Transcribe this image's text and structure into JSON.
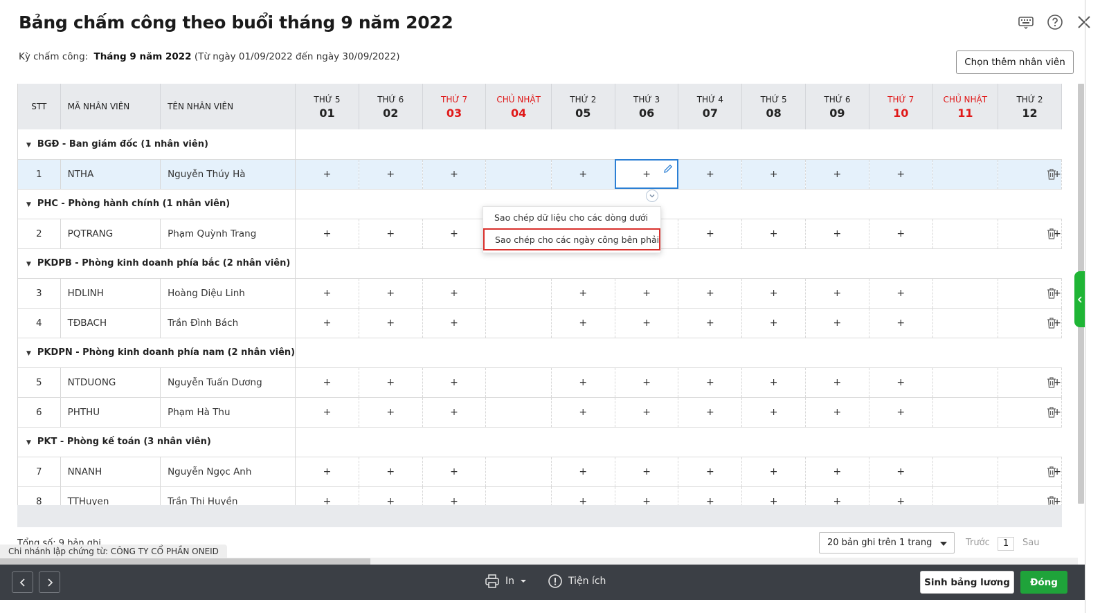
{
  "dialog": {
    "title": "Bảng chấm công theo buổi tháng 9 năm 2022",
    "period_label": "Kỳ chấm công:",
    "period_value": "Tháng 9 năm 2022",
    "period_range": " (Từ ngày 01/09/2022 đến ngày 30/09/2022)",
    "add_employee_label": "Chọn thêm nhân viên"
  },
  "table": {
    "headers": {
      "stt": "STT",
      "code": "MÃ NHÂN VIÊN",
      "name": "TÊN NHÂN VIÊN"
    },
    "days": [
      {
        "dow": "THỨ 5",
        "num": "01",
        "weekend": false
      },
      {
        "dow": "THỨ 6",
        "num": "02",
        "weekend": false
      },
      {
        "dow": "THỨ 7",
        "num": "03",
        "weekend": true
      },
      {
        "dow": "CHỦ NHẬT",
        "num": "04",
        "weekend": true
      },
      {
        "dow": "THỨ 2",
        "num": "05",
        "weekend": false
      },
      {
        "dow": "THỨ 3",
        "num": "06",
        "weekend": false
      },
      {
        "dow": "THỨ 4",
        "num": "07",
        "weekend": false
      },
      {
        "dow": "THỨ 5",
        "num": "08",
        "weekend": false
      },
      {
        "dow": "THỨ 6",
        "num": "09",
        "weekend": false
      },
      {
        "dow": "THỨ 7",
        "num": "10",
        "weekend": true
      },
      {
        "dow": "CHỦ NHẬT",
        "num": "11",
        "weekend": true
      },
      {
        "dow": "THỨ 2",
        "num": "12",
        "weekend": false
      }
    ],
    "cell_mark": "+",
    "groups": [
      {
        "label": "BGĐ - Ban giám đốc (1 nhân viên)",
        "rows": [
          {
            "stt": "1",
            "code": "NTHA",
            "name": "Nguyễn Thúy Hà"
          }
        ]
      },
      {
        "label": "PHC - Phòng hành chính (1 nhân viên)",
        "rows": [
          {
            "stt": "2",
            "code": "PQTRANG",
            "name": "Phạm Quỳnh Trang"
          }
        ]
      },
      {
        "label": "PKDPB - Phòng kinh doanh phía bắc (2 nhân viên)",
        "rows": [
          {
            "stt": "3",
            "code": "HDLINH",
            "name": "Hoàng Diệu Linh"
          },
          {
            "stt": "4",
            "code": "TĐBACH",
            "name": "Trần Đình Bách"
          }
        ]
      },
      {
        "label": "PKDPN - Phòng kinh doanh phía nam (2 nhân viên)",
        "rows": [
          {
            "stt": "5",
            "code": "NTDUONG",
            "name": "Nguyễn Tuấn Dương"
          },
          {
            "stt": "6",
            "code": "PHTHU",
            "name": "Phạm Hà Thu"
          }
        ]
      },
      {
        "label": "PKT - Phòng kế toán (3 nhân viên)",
        "rows": [
          {
            "stt": "7",
            "code": "NNANH",
            "name": "Nguyễn Ngọc Anh"
          },
          {
            "stt": "8",
            "code": "TTHuyen",
            "name": "Trần Thị Huyền"
          }
        ]
      }
    ]
  },
  "context_menu": {
    "copy_down": "Sao chép dữ liệu cho các dòng dưới",
    "copy_right": "Sao chép cho các ngày công bên phải"
  },
  "footer": {
    "total": "Tổng số: 9 bản ghi",
    "branch": "Chi nhánh lập chứng từ: CÔNG TY CỔ PHẦN ONEID",
    "page_size": "20 bản ghi trên 1 trang",
    "prev": "Trước",
    "page": "1",
    "next": "Sau"
  },
  "toolbar": {
    "print_label": "In",
    "utilities_label": "Tiện ích",
    "payroll_label": "Sinh bảng lương",
    "close_label": "Đóng"
  },
  "colors": {
    "weekend": "#e01818",
    "accent_green": "#1fa33a",
    "selected_row": "#e5f1fb",
    "highlight_red": "#d9302c"
  }
}
